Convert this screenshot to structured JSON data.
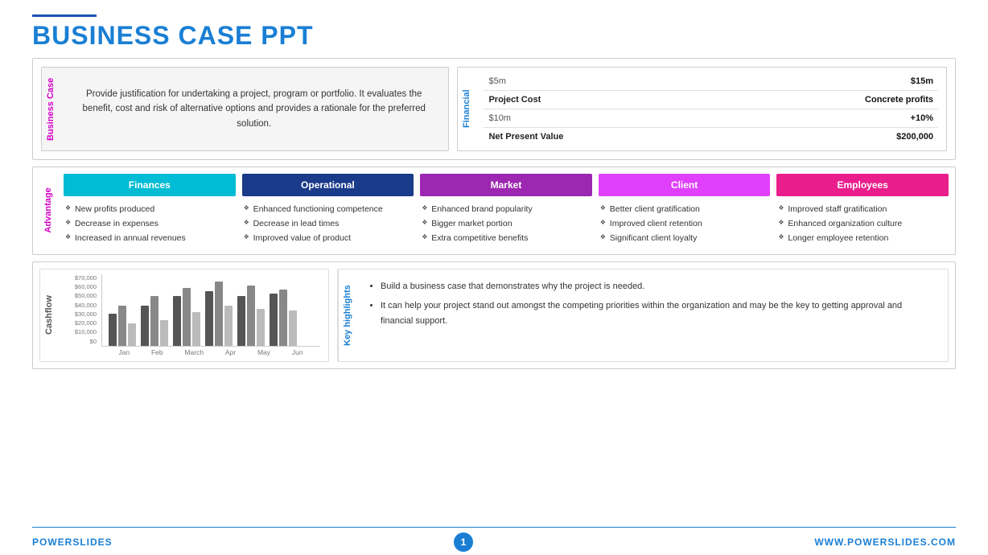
{
  "header": {
    "line_accent": "#1a56b0",
    "title_part1": "BUSINESS ",
    "title_part2": "CASE PPT"
  },
  "business_case": {
    "vertical_label": "Business Case",
    "description": "Provide justification for undertaking a project, program or portfolio. It evaluates the benefit, cost and risk of alternative options and provides a rationale for the preferred solution."
  },
  "financial": {
    "vertical_label": "Financial",
    "rows": [
      {
        "left": "$5m",
        "right": "$15m"
      },
      {
        "left": "Project Cost",
        "right": "Concrete profits"
      },
      {
        "left": "$10m",
        "right": "+10%"
      },
      {
        "left": "Net Present Value",
        "right": "$200,000"
      }
    ]
  },
  "advantage": {
    "vertical_label": "Advantage",
    "columns": [
      {
        "id": "finances",
        "header": "Finances",
        "color_class": "col-finances",
        "items": [
          "New profits produced",
          "Decrease in expenses",
          "Increased in annual revenues"
        ]
      },
      {
        "id": "operational",
        "header": "Operational",
        "color_class": "col-operational",
        "items": [
          "Enhanced functioning competence",
          "Decrease in lead times",
          "Improved value of product"
        ]
      },
      {
        "id": "market",
        "header": "Market",
        "color_class": "col-market",
        "items": [
          "Enhanced brand popularity",
          "Bigger market portion",
          "Extra competitive benefits"
        ]
      },
      {
        "id": "client",
        "header": "Client",
        "color_class": "col-client",
        "items": [
          "Better client gratification",
          "Improved client retention",
          "Significant client loyalty"
        ]
      },
      {
        "id": "employees",
        "header": "Employees",
        "color_class": "col-employees",
        "items": [
          "Improved staff gratification",
          "Enhanced organization culture",
          "Longer employee retention"
        ]
      }
    ]
  },
  "cashflow": {
    "vertical_label": "Cashflow",
    "y_labels": [
      "$70,000",
      "$60,000",
      "$50,000",
      "$40,000",
      "$30,000",
      "$20,000",
      "$10,000",
      "$0"
    ],
    "x_labels": [
      "Jan",
      "Feb",
      "March",
      "Apr",
      "May",
      "Jun"
    ],
    "bars": [
      [
        40,
        50,
        30
      ],
      [
        50,
        60,
        35
      ],
      [
        60,
        70,
        45
      ],
      [
        65,
        75,
        50
      ],
      [
        60,
        72,
        48
      ],
      [
        62,
        68,
        44
      ]
    ]
  },
  "key_highlights": {
    "label": "Key highlights",
    "items": [
      "Build a business case that demonstrates why the project is needed.",
      "It can help your project stand out amongst the competing priorities within the organization and may be the key to getting approval and financial support."
    ]
  },
  "footer": {
    "brand_part1": "POWER",
    "brand_part2": "SLIDES",
    "page_number": "1",
    "url": "WWW.POWERSLIDES.COM"
  }
}
